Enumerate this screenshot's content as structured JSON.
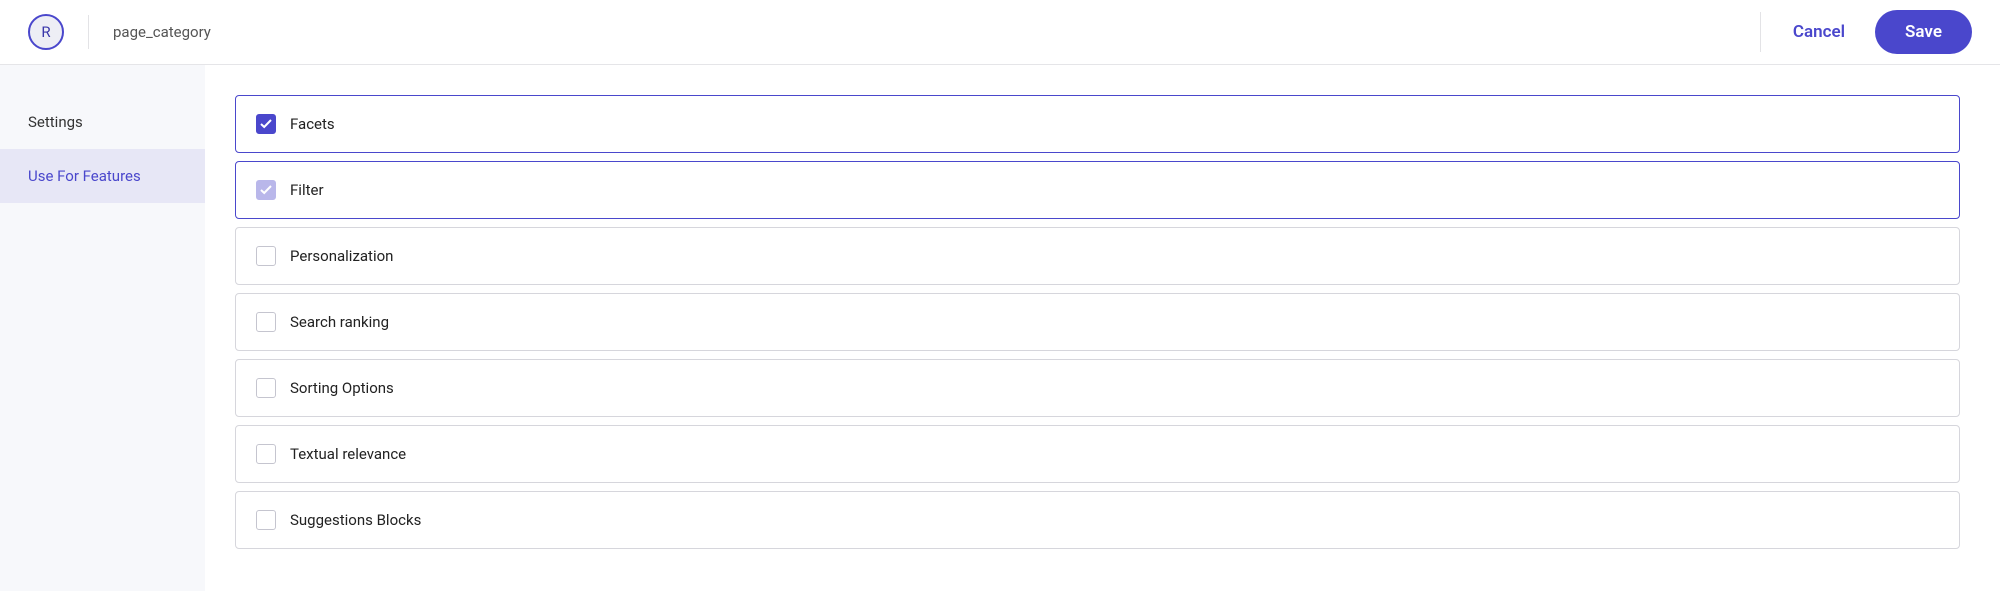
{
  "header": {
    "avatar_letter": "R",
    "page_title": "page_category",
    "cancel_label": "Cancel",
    "save_label": "Save"
  },
  "sidebar": {
    "items": [
      {
        "label": "Settings",
        "active": false
      },
      {
        "label": "Use For Features",
        "active": true
      }
    ]
  },
  "features": [
    {
      "label": "Facets",
      "checked": true,
      "check_style": "strong"
    },
    {
      "label": "Filter",
      "checked": true,
      "check_style": "light"
    },
    {
      "label": "Personalization",
      "checked": false
    },
    {
      "label": "Search ranking",
      "checked": false
    },
    {
      "label": "Sorting Options",
      "checked": false
    },
    {
      "label": "Textual relevance",
      "checked": false
    },
    {
      "label": "Suggestions Blocks",
      "checked": false
    }
  ]
}
